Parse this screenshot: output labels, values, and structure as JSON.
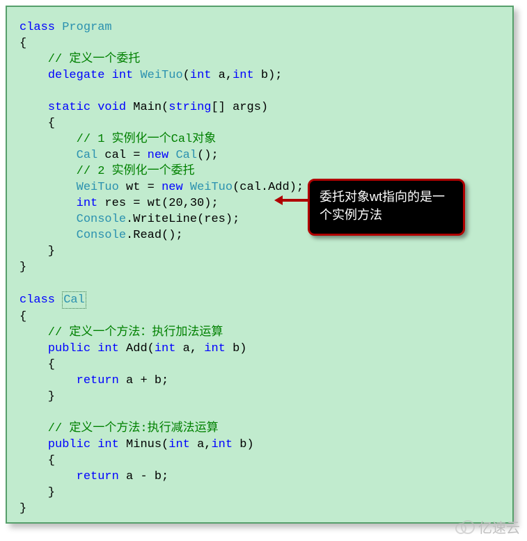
{
  "code": {
    "line1_kw": "class",
    "line1_type": " Program",
    "line2": "{",
    "line3_cmt": "    // 定义一个委托",
    "line4_a": "    ",
    "line4_kw1": "delegate",
    "line4_sp1": " ",
    "line4_kw2": "int",
    "line4_sp2": " ",
    "line4_type": "WeiTuo",
    "line4_b": "(",
    "line4_kw3": "int",
    "line4_c": " a,",
    "line4_kw4": "int",
    "line4_d": " b);",
    "line6_a": "    ",
    "line6_kw1": "static",
    "line6_sp1": " ",
    "line6_kw2": "void",
    "line6_b": " Main(",
    "line6_kw3": "string",
    "line6_c": "[] args)",
    "line7": "    {",
    "line8_cmt": "        // 1 实例化一个Cal对象",
    "line9_a": "        ",
    "line9_type1": "Cal",
    "line9_b": " cal = ",
    "line9_kw": "new",
    "line9_sp": " ",
    "line9_type2": "Cal",
    "line9_c": "();",
    "line10_cmt": "        // 2 实例化一个委托",
    "line11_a": "        ",
    "line11_type1": "WeiTuo",
    "line11_b": " wt = ",
    "line11_kw": "new",
    "line11_sp": " ",
    "line11_type2": "WeiTuo",
    "line11_c": "(cal.Add);",
    "line12_a": "        ",
    "line12_kw": "int",
    "line12_b": " res = wt(20,30);",
    "line13_a": "        ",
    "line13_type": "Console",
    "line13_b": ".WriteLine(res);",
    "line14_a": "        ",
    "line14_type": "Console",
    "line14_b": ".Read();",
    "line15": "    }",
    "line16": "}",
    "line18_kw": "class",
    "line18_sp": " ",
    "line18_type": "Cal",
    "line19": "{",
    "line20_cmt": "    // 定义一个方法：执行加法运算",
    "line21_a": "    ",
    "line21_kw1": "public",
    "line21_sp1": " ",
    "line21_kw2": "int",
    "line21_b": " Add(",
    "line21_kw3": "int",
    "line21_c": " a, ",
    "line21_kw4": "int",
    "line21_d": " b)",
    "line22": "    {",
    "line23_a": "        ",
    "line23_kw": "return",
    "line23_b": " a + b;",
    "line24": "    }",
    "line26_cmt": "    // 定义一个方法:执行减法运算",
    "line27_a": "    ",
    "line27_kw1": "public",
    "line27_sp1": " ",
    "line27_kw2": "int",
    "line27_b": " Minus(",
    "line27_kw3": "int",
    "line27_c": " a,",
    "line27_kw4": "int",
    "line27_d": " b)",
    "line28": "    {",
    "line29_a": "        ",
    "line29_kw": "return",
    "line29_b": " a - b;",
    "line30": "    }",
    "line31": "}"
  },
  "annotation": "委托对象wt指向的是一个实例方法",
  "watermark": "亿速云"
}
